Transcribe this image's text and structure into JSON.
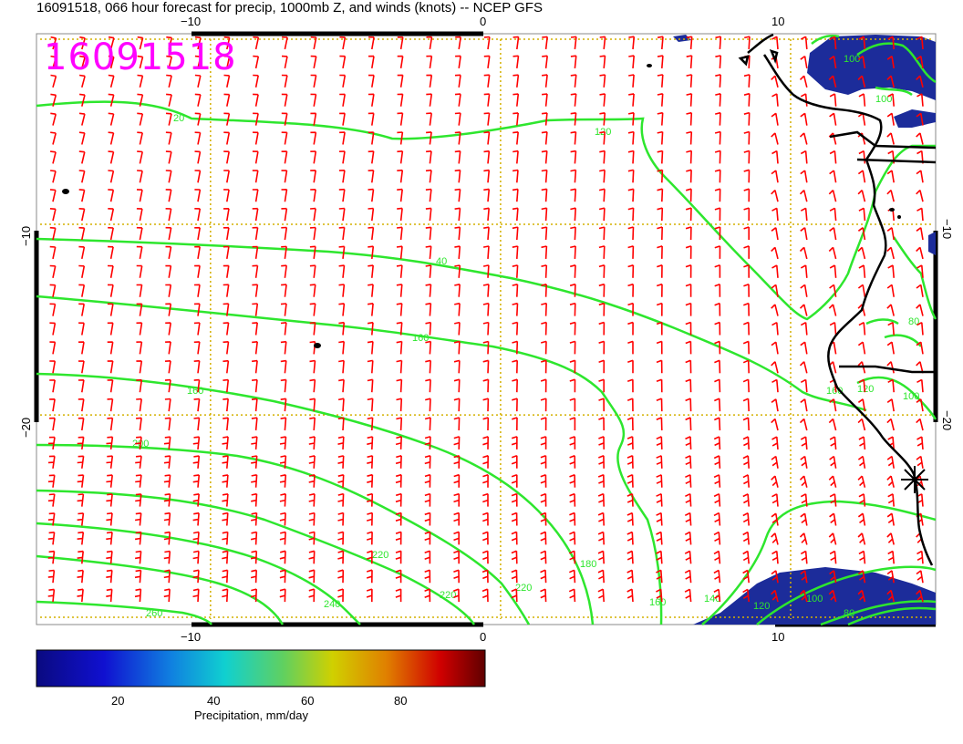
{
  "header": {
    "title": "16091518, 066 hour forecast for precip, 1000mb Z, and winds (knots) -- NCEP GFS",
    "stamp": "16091518"
  },
  "map": {
    "lon_range": [
      -16,
      15
    ],
    "lat_range": [
      -31,
      0
    ],
    "lon_ticks": [
      -10,
      0,
      10
    ],
    "lat_ticks": [
      -10,
      -20
    ],
    "lon_tick_labels": [
      "−10",
      "0",
      "10"
    ],
    "lat_tick_labels": [
      "−10",
      "−20"
    ],
    "grid": "dotted",
    "grid_color": "#d4b000",
    "contour_color": "#2ee62e",
    "barb_color": "#ff0000",
    "coast_color": "#000000",
    "contour_labels": [
      "20",
      "40",
      "80",
      "100",
      "120",
      "140",
      "160",
      "180",
      "200",
      "220",
      "240",
      "260"
    ],
    "marker": "asterisk"
  },
  "colorbar": {
    "label": "Precipitation, mm/day",
    "ticks": [
      "20",
      "40",
      "60",
      "80"
    ]
  }
}
